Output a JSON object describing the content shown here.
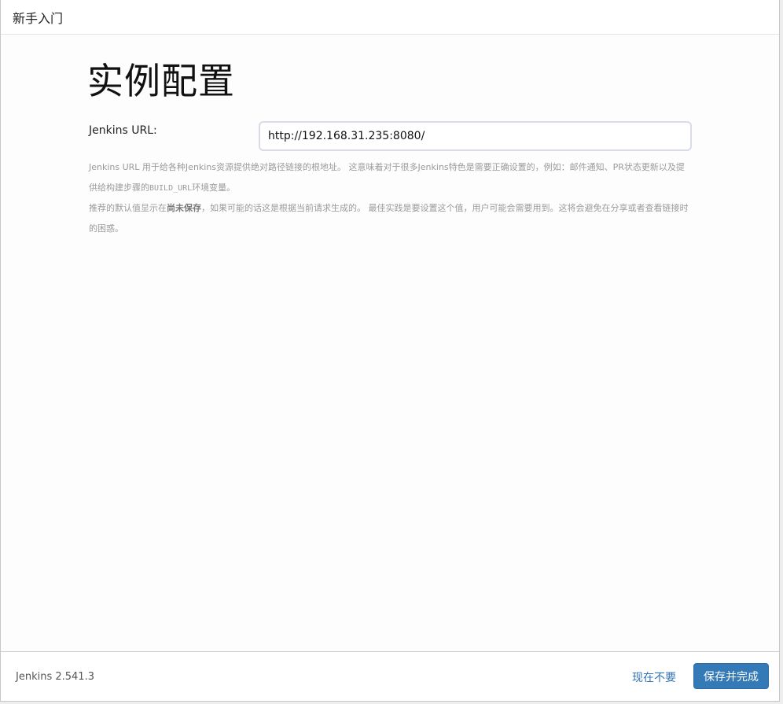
{
  "header": {
    "title": "新手入门"
  },
  "main": {
    "title": "实例配置",
    "field": {
      "label": "Jenkins URL:",
      "value": "http://192.168.31.235:8080/"
    },
    "help": {
      "p1_a": "Jenkins URL 用于给各种Jenkins资源提供绝对路径链接的根地址。 这意味着对于很多Jenkins特色是需要正确设置的，例如：邮件通知、PR状态更新以及提供给构建步骤的",
      "p1_code": "BUILD_URL",
      "p1_b": "环境变量。",
      "p2_a": "推荐的默认值显示在",
      "p2_bold": "尚未保存",
      "p2_b": "，如果可能的话这是根据当前请求生成的。 最佳实践是要设置这个值，用户可能会需要用到。这将会避免在分享或者查看链接时的困惑。"
    }
  },
  "footer": {
    "version": "Jenkins 2.541.3",
    "skip_label": "现在不要",
    "save_label": "保存并完成"
  },
  "colors": {
    "primary_button": "#337ab7",
    "link": "#3273b4"
  }
}
